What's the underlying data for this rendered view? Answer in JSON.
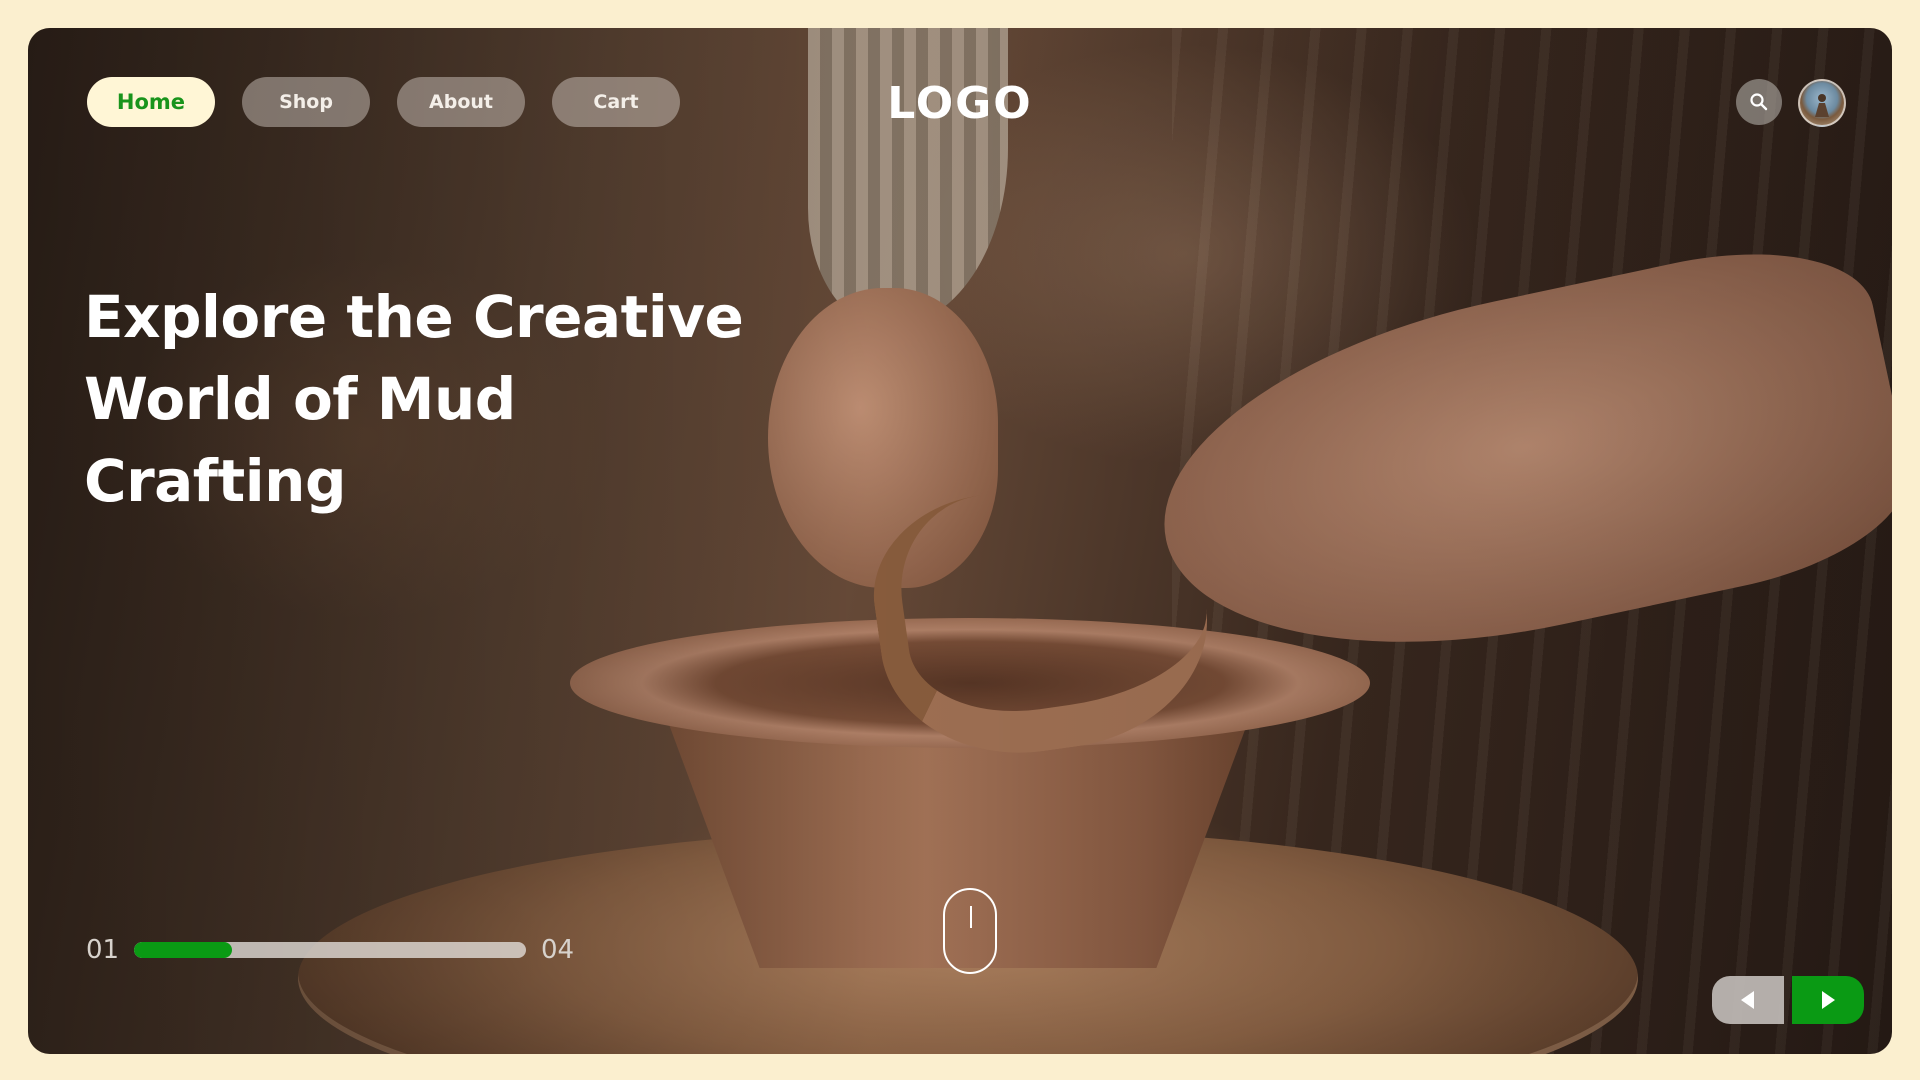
{
  "nav": {
    "items": [
      {
        "label": "Home",
        "active": true
      },
      {
        "label": "Shop",
        "active": false
      },
      {
        "label": "About",
        "active": false
      },
      {
        "label": "Cart",
        "active": false
      }
    ]
  },
  "brand": {
    "logo_text": "LOGO"
  },
  "header_icons": {
    "search": "search-icon",
    "avatar": "user-avatar"
  },
  "hero": {
    "title_line1": "Explore the Creative",
    "title_line2": "World of Mud",
    "title_line3": "Crafting",
    "image_subject": "potter shaping clay bowl on wheel"
  },
  "slider": {
    "current": "01",
    "total": "04",
    "progress_fraction": 0.25
  },
  "scroll_indicator": "mouse-scroll-icon",
  "controls": {
    "prev_icon": "arrow-left-icon",
    "next_icon": "arrow-right-icon"
  },
  "colors": {
    "page_background": "#fbefcf",
    "accent_green": "#0a9a14",
    "active_nav_text": "#19941c",
    "active_nav_background": "#fff6d6"
  }
}
